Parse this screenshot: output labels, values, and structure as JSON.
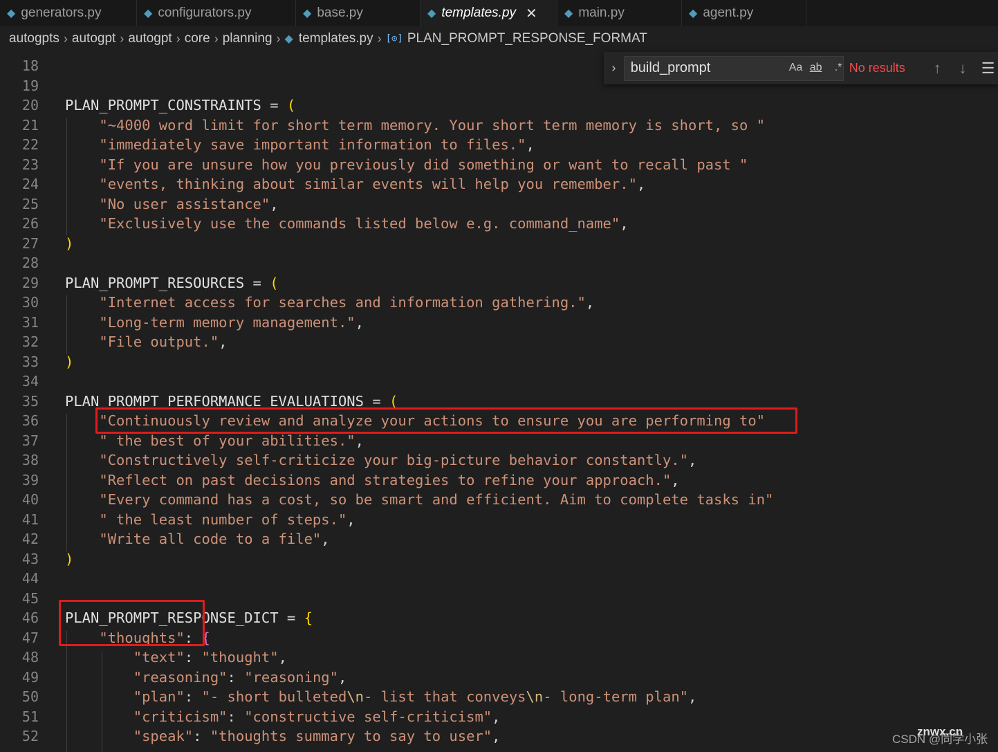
{
  "tabs": [
    {
      "label": "generators.py"
    },
    {
      "label": "configurators.py"
    },
    {
      "label": "base.py"
    },
    {
      "label": "templates.py",
      "active": true
    },
    {
      "label": "main.py"
    },
    {
      "label": "agent.py"
    }
  ],
  "breadcrumb": [
    "autogpts",
    "autogpt",
    "autogpt",
    "core",
    "planning",
    "templates.py",
    "PLAN_PROMPT_RESPONSE_FORMAT"
  ],
  "find": {
    "query": "build_prompt",
    "match_case_label": "Aa",
    "whole_word_label": "ab",
    "regex_label": ".*",
    "status": "No results"
  },
  "lines": [
    {
      "n": "18",
      "code": ""
    },
    {
      "n": "19",
      "code": ""
    },
    {
      "n": "20",
      "code": "PLAN_PROMPT_CONSTRAINTS = ("
    },
    {
      "n": "21",
      "code": "    \"~4000 word limit for short term memory. Your short term memory is short, so \""
    },
    {
      "n": "22",
      "code": "    \"immediately save important information to files.\","
    },
    {
      "n": "23",
      "code": "    \"If you are unsure how you previously did something or want to recall past \""
    },
    {
      "n": "24",
      "code": "    \"events, thinking about similar events will help you remember.\","
    },
    {
      "n": "25",
      "code": "    \"No user assistance\","
    },
    {
      "n": "26",
      "code": "    \"Exclusively use the commands listed below e.g. command_name\","
    },
    {
      "n": "27",
      "code": ")"
    },
    {
      "n": "28",
      "code": ""
    },
    {
      "n": "29",
      "code": "PLAN_PROMPT_RESOURCES = ("
    },
    {
      "n": "30",
      "code": "    \"Internet access for searches and information gathering.\","
    },
    {
      "n": "31",
      "code": "    \"Long-term memory management.\","
    },
    {
      "n": "32",
      "code": "    \"File output.\","
    },
    {
      "n": "33",
      "code": ")"
    },
    {
      "n": "34",
      "code": ""
    },
    {
      "n": "35",
      "code": "PLAN_PROMPT_PERFORMANCE_EVALUATIONS = ("
    },
    {
      "n": "36",
      "code": "    \"Continuously review and analyze your actions to ensure you are performing to\""
    },
    {
      "n": "37",
      "code": "    \" the best of your abilities.\","
    },
    {
      "n": "38",
      "code": "    \"Constructively self-criticize your big-picture behavior constantly.\","
    },
    {
      "n": "39",
      "code": "    \"Reflect on past decisions and strategies to refine your approach.\","
    },
    {
      "n": "40",
      "code": "    \"Every command has a cost, so be smart and efficient. Aim to complete tasks in\""
    },
    {
      "n": "41",
      "code": "    \" the least number of steps.\","
    },
    {
      "n": "42",
      "code": "    \"Write all code to a file\","
    },
    {
      "n": "43",
      "code": ")"
    },
    {
      "n": "44",
      "code": ""
    },
    {
      "n": "45",
      "code": ""
    },
    {
      "n": "46",
      "code": "PLAN_PROMPT_RESPONSE_DICT = {"
    },
    {
      "n": "47",
      "code": "    \"thoughts\": {"
    },
    {
      "n": "48",
      "code": "        \"text\": \"thought\","
    },
    {
      "n": "49",
      "code": "        \"reasoning\": \"reasoning\","
    },
    {
      "n": "50",
      "code": "        \"plan\": \"- short bulleted\\n- list that conveys\\n- long-term plan\","
    },
    {
      "n": "51",
      "code": "        \"criticism\": \"constructive self-criticism\","
    },
    {
      "n": "52",
      "code": "        \"speak\": \"thoughts summary to say to user\","
    }
  ],
  "watermark": "CSDN @同学小张",
  "watermark2": "znwx.cn",
  "colors": {
    "background": "#1f1f1f",
    "string": "#ce9178",
    "identifier": "#e0e0e0",
    "bracket_level1": "#ffd700",
    "bracket_level2": "#da70d6",
    "highlight_box": "#e11b1b",
    "no_results": "#f14c4c"
  }
}
